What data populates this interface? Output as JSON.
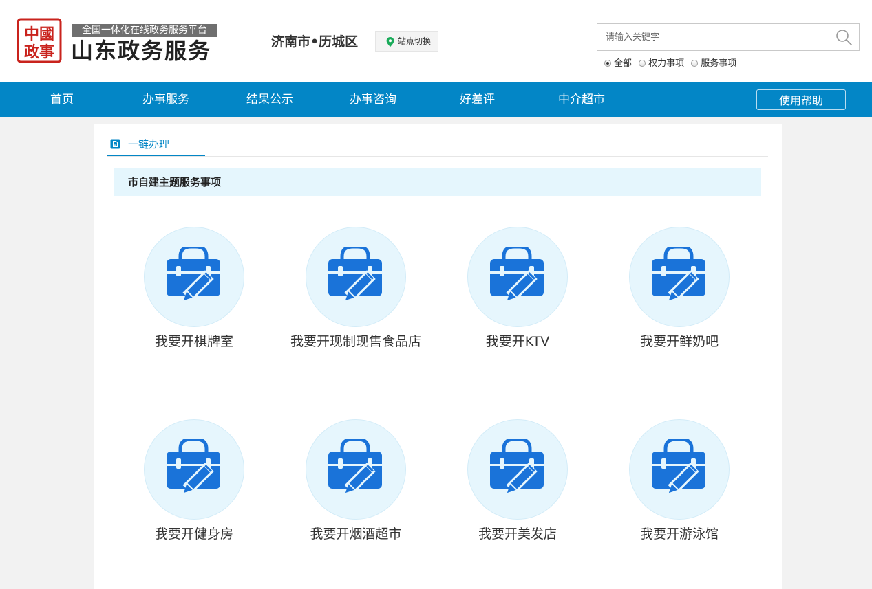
{
  "header": {
    "seal_text": "中國 政事",
    "tagline": "全国一体化在线政务服务平台",
    "brand": "山东政务服务",
    "region": "济南市•历城区",
    "site_switch": "站点切换",
    "search": {
      "placeholder": "请输入关键字",
      "value": ""
    },
    "filters": [
      {
        "label": "全部",
        "selected": true
      },
      {
        "label": "权力事项",
        "selected": false
      },
      {
        "label": "服务事项",
        "selected": false
      }
    ]
  },
  "nav": {
    "items": [
      "首页",
      "办事服务",
      "结果公示",
      "办事咨询",
      "好差评",
      "中介超市"
    ],
    "help": "使用帮助"
  },
  "content": {
    "tab": "一链办理",
    "section_title": "市自建主题服务事项",
    "services": [
      "我要开棋牌室",
      "我要开现制现售食品店",
      "我要开KTV",
      "我要开鲜奶吧",
      "我要开健身房",
      "我要开烟酒超市",
      "我要开美发店",
      "我要开游泳馆"
    ]
  },
  "colors": {
    "nav_bg": "#0386c6",
    "accent": "#0386c6",
    "icon_blue": "#1a73d9",
    "circle_bg": "#e6f6fd",
    "section_bg": "#e5f6fd"
  },
  "icons": {
    "seal": "china-government-seal-icon",
    "location": "map-pin-icon",
    "search": "magnifier-icon",
    "tab": "document-icon",
    "service": "briefcase-pen-icon"
  }
}
